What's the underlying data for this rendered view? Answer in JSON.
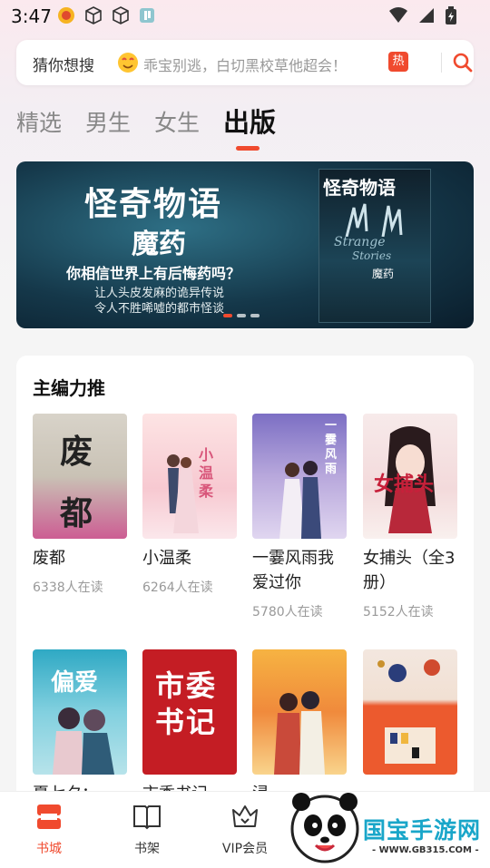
{
  "status": {
    "time": "3:47"
  },
  "search": {
    "label": "猜你想搜",
    "hint": "乖宝别逃，白切黑校草他超会！",
    "hot_badge": "热"
  },
  "tabs": [
    {
      "label": "精选"
    },
    {
      "label": "男生"
    },
    {
      "label": "女生"
    },
    {
      "label": "出版"
    }
  ],
  "banner": {
    "title": "怪奇物语",
    "subtitle": "魔药",
    "tagline": "你相信世界上有后悔药吗？",
    "line1": "让人头皮发麻的诡异传说",
    "line2": "令人不胜唏嘘的都市怪谈",
    "cover_title": "怪奇物语",
    "cover_en1": "Strange",
    "cover_en2": "Stories",
    "cover_sub": "魔药"
  },
  "section": {
    "title": "主编力推"
  },
  "books": [
    {
      "name": "废都",
      "readers": "6338人在读",
      "cover_text": "废 都"
    },
    {
      "name": "小温柔",
      "readers": "6264人在读",
      "cover_text": "小温柔"
    },
    {
      "name": "一霎风雨我爱过你",
      "readers": "5780人在读",
      "cover_text": "一霎风雨"
    },
    {
      "name": "女捕头（全3册）",
      "readers": "5152人在读",
      "cover_text": "女捕头"
    },
    {
      "name": "夏七夕：",
      "readers": "",
      "cover_text": "偏爱"
    },
    {
      "name": "市委书记",
      "readers": "",
      "cover_text": "市委书记"
    },
    {
      "name": "浸",
      "readers": "",
      "cover_text": ""
    },
    {
      "name": "",
      "readers": "",
      "cover_text": ""
    }
  ],
  "nav": [
    {
      "label": "书城"
    },
    {
      "label": "书架"
    },
    {
      "label": "VIP会员"
    }
  ],
  "watermark": {
    "brand": "国宝手游网",
    "url": "- WWW.GB315.COM -"
  },
  "colors": {
    "accent": "#f04a2e"
  }
}
